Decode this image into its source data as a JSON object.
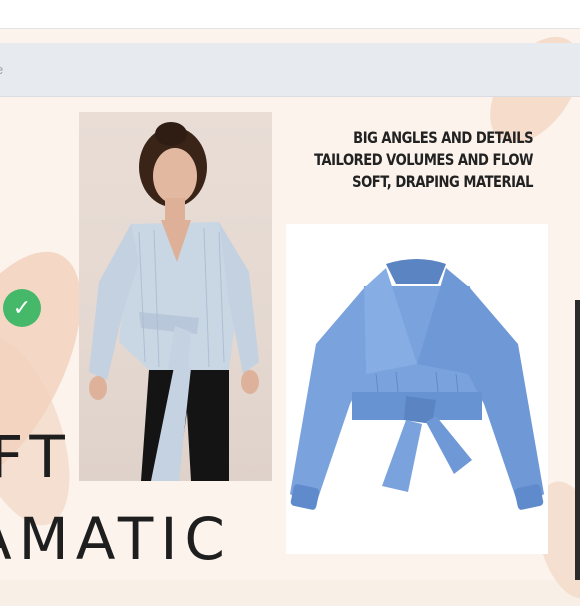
{
  "browser": {
    "address_text": "e"
  },
  "headline": {
    "lines": [
      "BIG ANGLES AND DETAILS",
      "TAILORED VOLUMES AND FLOW",
      "SOFT, DRAPING MATERIAL"
    ]
  },
  "title": {
    "line1": "FT",
    "line2": "AMATIC"
  },
  "badge": {
    "icon": "check-icon",
    "glyph": "✓",
    "color": "#45b86a"
  },
  "colors": {
    "page_background": "#fbf3ec",
    "brush_accent": "#f2d2be",
    "blouse_blue": "#7aa3de"
  }
}
